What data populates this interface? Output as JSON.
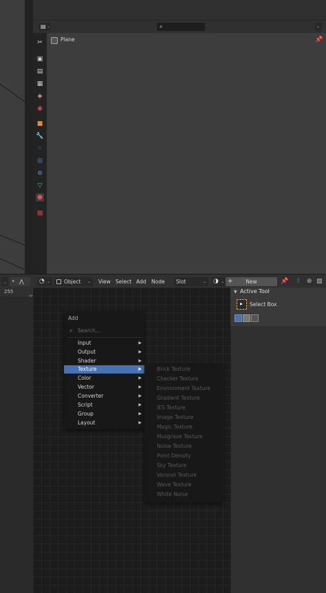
{
  "properties": {
    "search_placeholder": "",
    "object_name": "Plane"
  },
  "node_header": {
    "editor_type_icon": "node-editor-icon",
    "object_dropdown": "Object",
    "menus": [
      "View",
      "Select",
      "Add",
      "Node"
    ],
    "slot_dropdown": "Slot",
    "new_button": "New"
  },
  "left_strip": {
    "value": "255"
  },
  "add_menu": {
    "title": "Add",
    "search_placeholder": "Search...",
    "items": [
      {
        "label": "Input",
        "underline": "I",
        "rest": "nput"
      },
      {
        "label": "Output",
        "underline": "O",
        "rest": "utput"
      },
      {
        "label": "Shader",
        "underline": "S",
        "rest": "hader"
      },
      {
        "label": "Texture",
        "underline": "T",
        "rest": "exture"
      },
      {
        "label": "Color",
        "underline": "C",
        "rest": "olor"
      },
      {
        "label": "Vector",
        "underline": "V",
        "rest": "ector"
      },
      {
        "label": "Converter",
        "underline": "C",
        "rest": "onverter"
      },
      {
        "label": "Script",
        "underline": "S",
        "rest": "cript"
      },
      {
        "label": "Group",
        "underline": "G",
        "rest": "roup"
      },
      {
        "label": "Layout",
        "underline": "L",
        "rest": "ayout"
      }
    ],
    "highlighted": "Texture"
  },
  "texture_menu": {
    "items": [
      "Brick Texture",
      "Checker Texture",
      "Environment Texture",
      "Gradient Texture",
      "IES Texture",
      "Image Texture",
      "Magic Texture",
      "Musgrave Texture",
      "Noise Texture",
      "Point Density",
      "Sky Texture",
      "Voronoi Texture",
      "Wave Texture",
      "White Noise"
    ]
  },
  "sidebar": {
    "panel_title": "Active Tool",
    "tool_name": "Select Box"
  },
  "colors": {
    "highlight": "#4772b3",
    "tool_accent": "#e8a13a"
  }
}
